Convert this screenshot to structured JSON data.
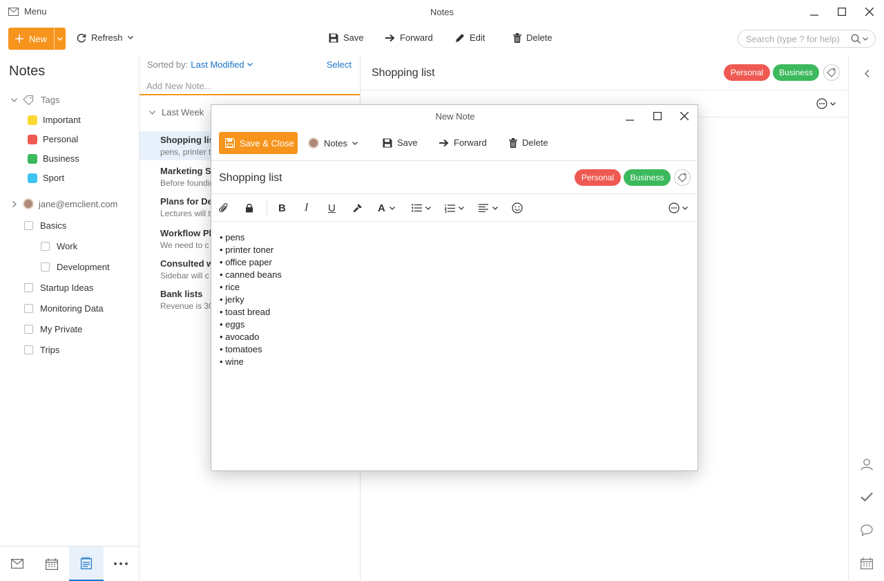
{
  "window": {
    "menu_label": "Menu",
    "title": "Notes"
  },
  "toolbar": {
    "new_label": "New",
    "refresh_label": "Refresh",
    "save_label": "Save",
    "forward_label": "Forward",
    "edit_label": "Edit",
    "delete_label": "Delete",
    "search_placeholder": "Search (type ? for help)"
  },
  "sidebar": {
    "title": "Notes",
    "tags_label": "Tags",
    "tags": [
      {
        "label": "Important",
        "color": "#fdd835"
      },
      {
        "label": "Personal",
        "color": "#ee5a52"
      },
      {
        "label": "Business",
        "color": "#3cb95c"
      },
      {
        "label": "Sport",
        "color": "#3fc3f2"
      }
    ],
    "account": "jane@emclient.com",
    "folders": [
      "Basics",
      "Work",
      "Development",
      "Startup Ideas",
      "Monitoring Data",
      "My Private",
      "Trips"
    ]
  },
  "notelist": {
    "sorted_by_label": "Sorted by:",
    "sorted_by_value": "Last Modified",
    "select_label": "Select",
    "add_placeholder": "Add New Note...",
    "group_label": "Last Week",
    "items": [
      {
        "title": "Shopping list",
        "preview": "pens, printer toner"
      },
      {
        "title": "Marketing S",
        "preview": "Before founding"
      },
      {
        "title": "Plans for De",
        "preview": "Lectures will t"
      },
      {
        "title": "Workflow Pl",
        "preview": "We need to c"
      },
      {
        "title": "Consulted w",
        "preview": "Sidebar will c"
      },
      {
        "title": "Bank lists",
        "preview": "Revenue is 30"
      }
    ]
  },
  "rightpane": {
    "title": "Shopping list",
    "tag_personal": "Personal",
    "tag_business": "Business"
  },
  "modal": {
    "title": "New Note",
    "save_close_label": "Save & Close",
    "notes_label": "Notes",
    "save_label": "Save",
    "forward_label": "Forward",
    "delete_label": "Delete",
    "note_title": "Shopping list",
    "tag_personal": "Personal",
    "tag_business": "Business",
    "body_items": [
      "pens",
      "printer toner",
      "office paper",
      "canned beans",
      "rice",
      "jerky",
      "toast bread",
      "eggs",
      "avocado",
      "tomatoes",
      "wine"
    ]
  },
  "colors": {
    "accent": "#f7941d",
    "link": "#1a73c9",
    "personal": "#ee5a52",
    "business": "#3cb95c"
  }
}
